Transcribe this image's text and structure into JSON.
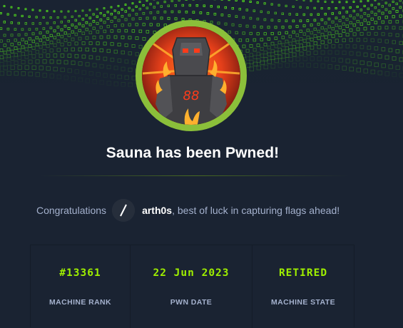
{
  "title": "Sauna has been Pwned!",
  "congrats": {
    "prefix": "Congratulations",
    "username": "arth0s",
    "suffix": ", best of luck in capturing flags ahead!"
  },
  "stats": [
    {
      "value": "#13361",
      "label": "MACHINE RANK"
    },
    {
      "value": "22 Jun 2023",
      "label": "PWN DATE"
    },
    {
      "value": "RETIRED",
      "label": "MACHINE STATE"
    }
  ],
  "colors": {
    "background": "#1a2332",
    "accent": "#9fef00",
    "ring": "#8bbf3a",
    "muted_text": "#a4b1cd"
  },
  "icons": {
    "banner": "green-cube-grid-banner",
    "machine": "sauna-machine-avatar",
    "user": "user-avatar-slash"
  }
}
